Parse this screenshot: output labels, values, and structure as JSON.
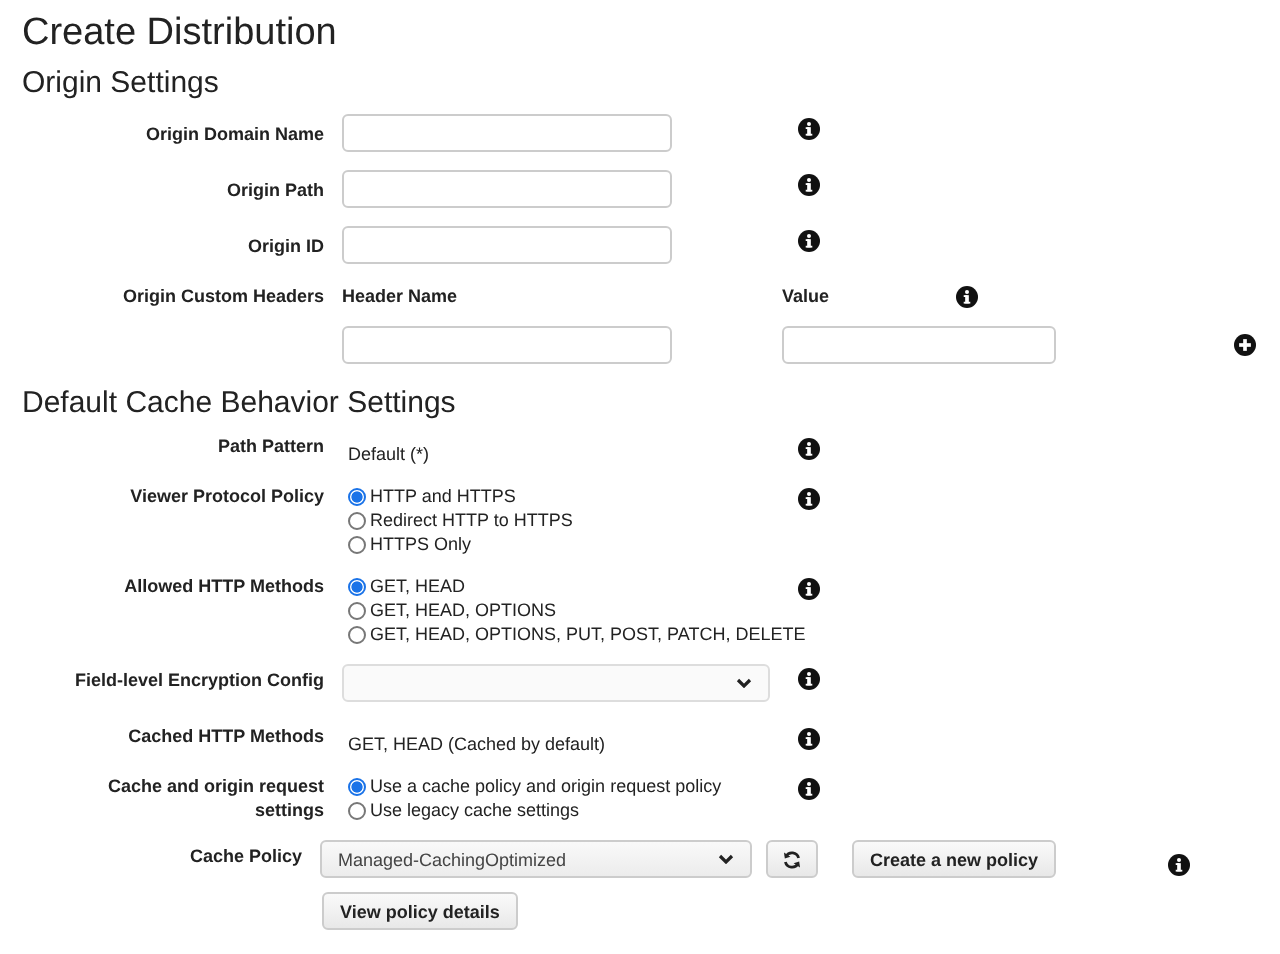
{
  "title": "Create Distribution",
  "sections": [
    {
      "heading": "Origin Settings",
      "rows": [
        {
          "kind": "input",
          "label": "Origin Domain Name"
        },
        {
          "kind": "input",
          "label": "Origin Path"
        },
        {
          "kind": "input",
          "label": "Origin ID"
        },
        {
          "kind": "headers",
          "label": "Origin Custom Headers",
          "name_heading": "Header Name",
          "value_heading": "Value"
        }
      ]
    },
    {
      "heading": "Default Cache Behavior Settings",
      "rows": [
        {
          "kind": "static",
          "label": "Path Pattern",
          "value": "Default (*)"
        },
        {
          "kind": "radio",
          "label": "Viewer Protocol Policy",
          "options": [
            {
              "label": "HTTP and HTTPS",
              "selected": true
            },
            {
              "label": "Redirect HTTP to HTTPS",
              "selected": false
            },
            {
              "label": "HTTPS Only",
              "selected": false
            }
          ]
        },
        {
          "kind": "radio",
          "label": "Allowed HTTP Methods",
          "options": [
            {
              "label": "GET, HEAD",
              "selected": true
            },
            {
              "label": "GET, HEAD, OPTIONS",
              "selected": false
            },
            {
              "label": "GET, HEAD, OPTIONS, PUT, POST, PATCH, DELETE",
              "selected": false
            }
          ]
        },
        {
          "kind": "select",
          "label": "Field-level Encryption Config"
        },
        {
          "kind": "static",
          "label": "Cached HTTP Methods",
          "value": "GET, HEAD (Cached by default)"
        },
        {
          "kind": "radio",
          "label": "Cache and origin request settings",
          "options": [
            {
              "label": "Use a cache policy and origin request policy",
              "selected": true
            },
            {
              "label": "Use legacy cache settings",
              "selected": false
            }
          ]
        },
        {
          "kind": "policy",
          "label": "Cache Policy",
          "value": "Managed-CachingOptimized",
          "create_button": "Create a new policy",
          "details_button": "View policy details"
        }
      ]
    }
  ]
}
